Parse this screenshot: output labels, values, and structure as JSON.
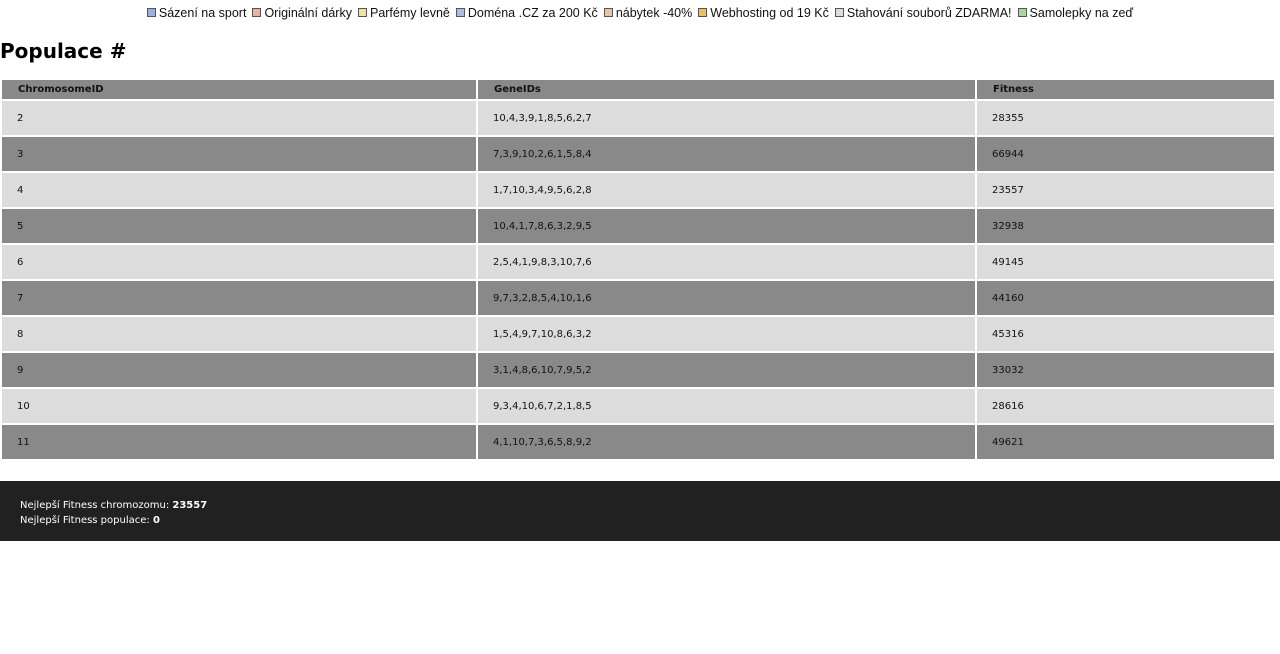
{
  "ad_links": [
    {
      "label": "Sázení na sport",
      "color": "#9db0dc"
    },
    {
      "label": "Originální dárky",
      "color": "#e8b3a0"
    },
    {
      "label": "Parfémy levně",
      "color": "#f2e3a0"
    },
    {
      "label": "Doména .CZ za 200 Kč",
      "color": "#a9bde0"
    },
    {
      "label": "nábytek -40%",
      "color": "#e5c4a8"
    },
    {
      "label": "Webhosting od 19 Kč",
      "color": "#f0c060"
    },
    {
      "label": "Stahování souborů ZDARMA!",
      "color": "#dddddd"
    },
    {
      "label": "Samolepky na zeď",
      "color": "#a8d8a0"
    }
  ],
  "page_title": "Populace #",
  "table": {
    "headers": [
      "ChromosomeID",
      "GeneIDs",
      "Fitness"
    ],
    "rows": [
      [
        "2",
        "10,4,3,9,1,8,5,6,2,7",
        "28355"
      ],
      [
        "3",
        "7,3,9,10,2,6,1,5,8,4",
        "66944"
      ],
      [
        "4",
        "1,7,10,3,4,9,5,6,2,8",
        "23557"
      ],
      [
        "5",
        "10,4,1,7,8,6,3,2,9,5",
        "32938"
      ],
      [
        "6",
        "2,5,4,1,9,8,3,10,7,6",
        "49145"
      ],
      [
        "7",
        "9,7,3,2,8,5,4,10,1,6",
        "44160"
      ],
      [
        "8",
        "1,5,4,9,7,10,8,6,3,2",
        "45316"
      ],
      [
        "9",
        "3,1,4,8,6,10,7,9,5,2",
        "33032"
      ],
      [
        "10",
        "9,3,4,10,6,7,2,1,8,5",
        "28616"
      ],
      [
        "11",
        "4,1,10,7,3,6,5,8,9,2",
        "49621"
      ]
    ]
  },
  "footer": {
    "best_chromosome_label": "Nejlepší Fitness chromozomu:",
    "best_chromosome_value": "23557",
    "best_population_label": "Nejlepší Fitness populace:",
    "best_population_value": "0"
  }
}
